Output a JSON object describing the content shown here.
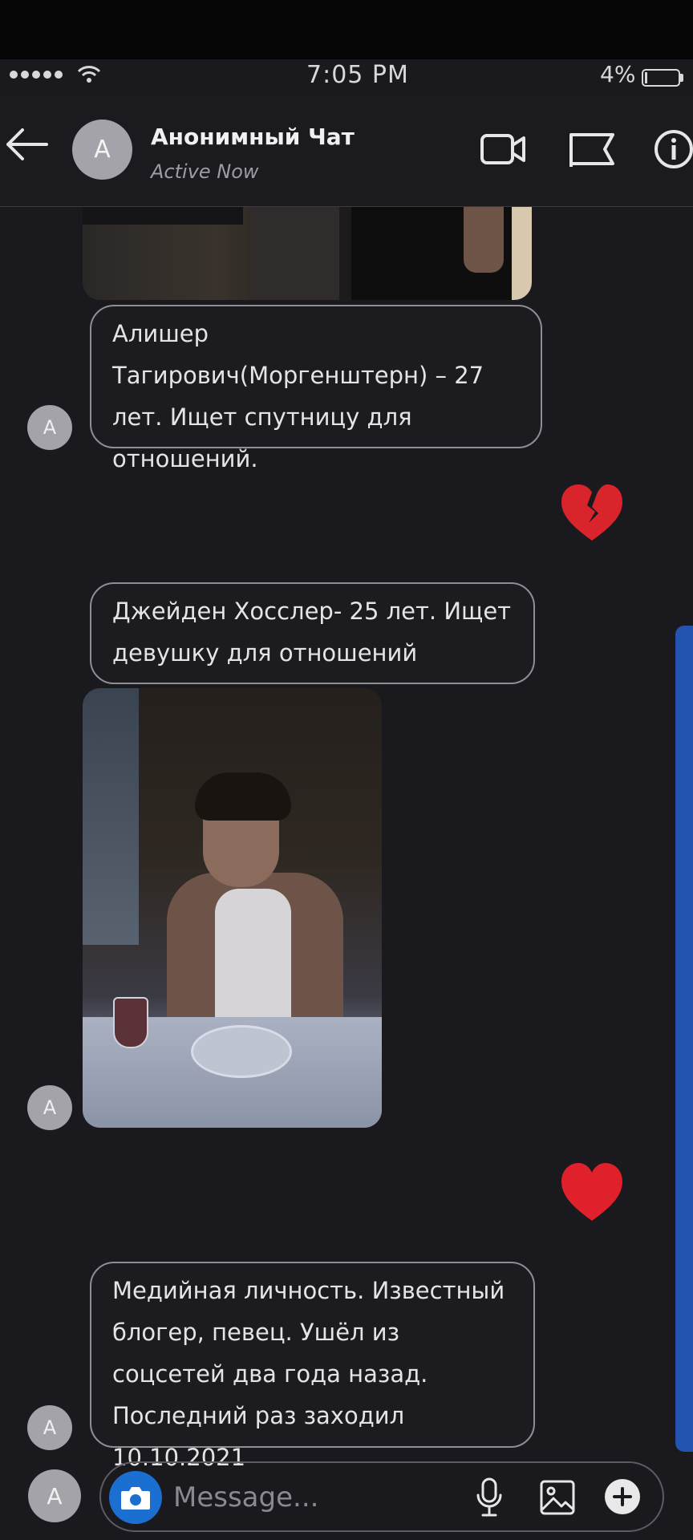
{
  "status_bar": {
    "time": "7:05 PM",
    "battery": "4%"
  },
  "header": {
    "avatar_letter": "A",
    "title": "Анонимный Чат",
    "status": "Active Now",
    "icons": [
      "back-arrow-icon",
      "video-call-icon",
      "flag-icon",
      "info-icon"
    ]
  },
  "messages": [
    {
      "type": "image",
      "description_icon": "photo"
    },
    {
      "type": "text",
      "avatar": "A",
      "text": "Алишер Тагирович(Моргенштерн) – 27 лет. Ищет спутницу для отношений."
    },
    {
      "type": "reaction",
      "emoji": "💔"
    },
    {
      "type": "text",
      "text": "Джейден Хосслер- 25 лет. Ищет девушку для отношений"
    },
    {
      "type": "image",
      "avatar": "A"
    },
    {
      "type": "reaction",
      "emoji": "❤️"
    },
    {
      "type": "text",
      "avatar": "A",
      "text": "Медийная личность. Известный блогер, певец. Ушёл из соцсетей два года назад. Последний раз заходил 10.10.2021"
    }
  ],
  "composer": {
    "avatar_letter": "A",
    "placeholder": "Message..."
  },
  "colors": {
    "background": "#1a191e",
    "accent_blue": "#1b6fd1",
    "scrollbar": "#2453b0",
    "avatar_gray": "#a4a3a9"
  }
}
